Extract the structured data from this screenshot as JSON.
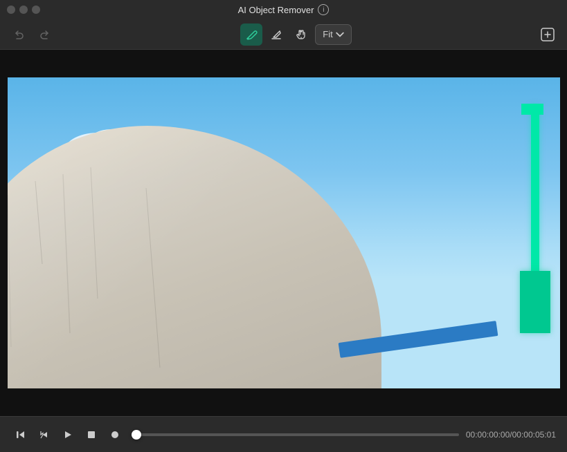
{
  "titleBar": {
    "title": "AI Object Remover",
    "infoLabel": "i"
  },
  "toolbar": {
    "undoLabel": "↩",
    "redoLabel": "↪",
    "brushLabel": "✏",
    "eraserLabel": "◻",
    "panLabel": "✋",
    "fitDropdown": {
      "label": "Fit",
      "chevron": "▾"
    },
    "exportLabel": "⬛"
  },
  "playback": {
    "prevFrameLabel": "⏮",
    "stepForwardLabel": "⏭",
    "playLabel": "▶",
    "stopLabel": "⏹",
    "recordLabel": "⏺",
    "timeCode": "00:00:00:00/00:00:05:01"
  }
}
